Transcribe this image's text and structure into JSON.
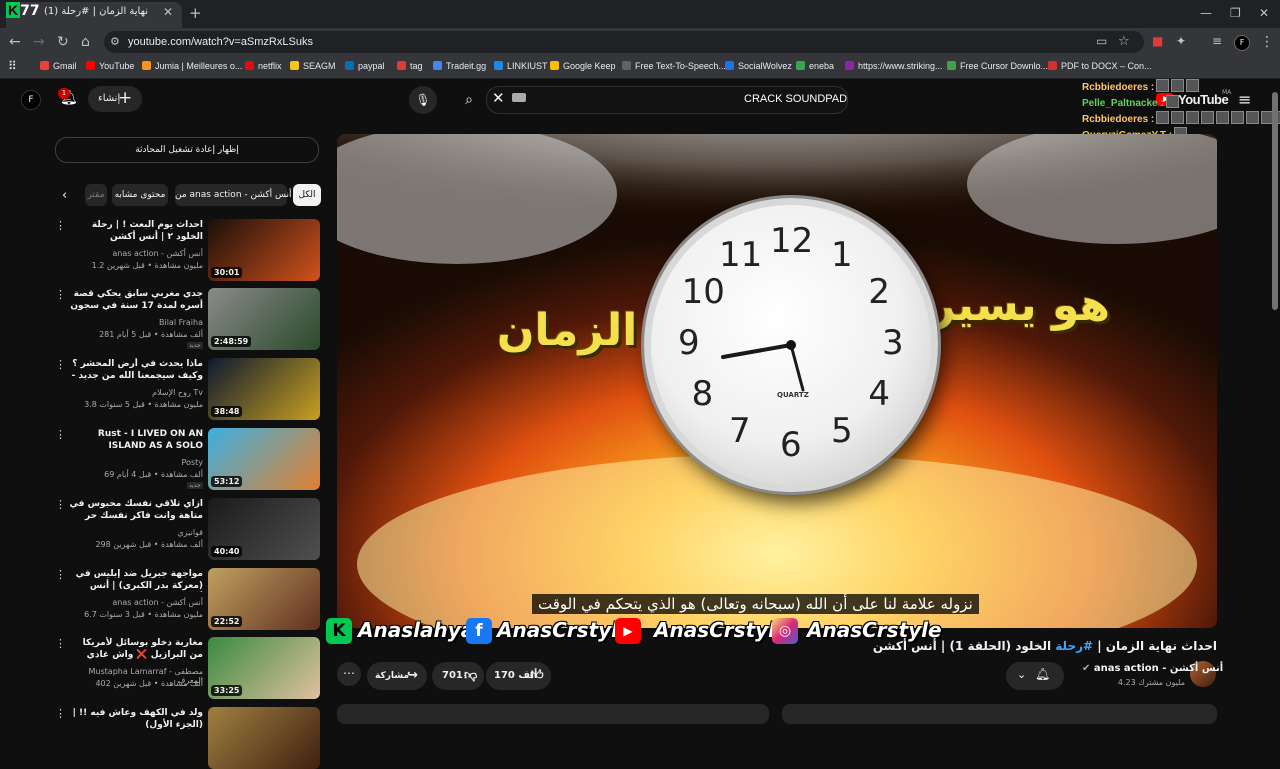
{
  "browser": {
    "tab_title": "(1) احداث نهاية الزمان | #رحلة",
    "tab_logo": "K77",
    "url": "youtube.com/watch?v=aSmzRxLSuks",
    "bookmarks": [
      "Gmail",
      "YouTube",
      "Jumia | Meilleures o...",
      "netflix",
      "SEAGM",
      "paypal",
      "tag",
      "Tradeit.gg",
      "LINKIUST",
      "Google Keep",
      "Free Text-To-Speech...",
      "SocialWolvez",
      "eneba",
      "https://www.striking...",
      "Free Cursor Downlo...",
      "PDF to DOCX – Con..."
    ],
    "bookmark_colors": [
      "#ea4335",
      "#ff0000",
      "#f7931e",
      "#e50914",
      "#f5c518",
      "#0070ba",
      "#e53935",
      "#4285f4",
      "#1e88e5",
      "#fbbc04",
      "#5f6368",
      "#1a73e8",
      "#34a853",
      "#8e24aa",
      "#43a047",
      "#d32f2f"
    ]
  },
  "header": {
    "avatar_letter": "F",
    "notif_count": "1",
    "create_label": "إنشاء",
    "search_query": "CRACK SOUNDPAD",
    "logo_text": "YouTube",
    "logo_region": "MA"
  },
  "chat_overlay": [
    {
      "user": "Rcbbiedoeres :",
      "color": "#ffc56b",
      "emotes": 3
    },
    {
      "user": "Pelle_Paltnacke :",
      "color": "#5fd35f",
      "emotes": 1
    },
    {
      "user": "Rcbbiedoeres :",
      "color": "#ffc56b",
      "emotes": 9
    },
    {
      "user": "QueryziGamezY.T :",
      "color": "#ffd000",
      "emotes": 1
    }
  ],
  "sidebar": {
    "chat_replay": "إظهار إعادة تشغيل المحادثة",
    "chips": [
      "الكل",
      "من anas action - أنس أكشن",
      "محتوى مشابه",
      "مقتر"
    ],
    "recommendations": [
      {
        "title": "احداث يوم البعث ! | رحلة الخلود ٢ | أنس أكشن",
        "channel": "anas action - أنس أكشن",
        "meta": "1.2 مليون مشاهدة • قبل شهرين",
        "duration": "30:01",
        "thumb": [
          "#1a0f0a",
          "#d2521c"
        ]
      },
      {
        "title": "جدي مغربي سابق يحكي قصة أسره لمدة 17 سنة في سجون البوليساريو | Dekka ...",
        "channel": "Bilal Fraiha",
        "meta": "281 ألف مشاهدة • قبل 5 أيام",
        "duration": "2:48:59",
        "thumb": [
          "#8a8a8a",
          "#2a4a2a"
        ],
        "new": "جديد"
      },
      {
        "title": "ماذا يحدث في أرض المحشر ؟ وكيف سيجمعنا الله من جديد - درس في منتهى الروعة للشي...",
        "channel": "روح الإسلام Tv",
        "meta": "3.8 مليون مشاهدة • قبل 5 سنوات",
        "duration": "38:48",
        "thumb": [
          "#0d1a30",
          "#c9a020"
        ]
      },
      {
        "title": "Rust - I LIVED ON AN ISLAND AS A SOLO",
        "channel": "Posty",
        "meta": "69 ألف مشاهدة • قبل 4 أيام",
        "duration": "53:12",
        "thumb": [
          "#3bb0e0",
          "#e08030"
        ],
        "new": "جديد"
      },
      {
        "title": "ازاي تلاقي نفسك محبوس في متاهة وانت فاكر نفسك حر !!؟ | Prisoners",
        "channel": "قوانيزي",
        "meta": "298 ألف مشاهدة • قبل شهرين",
        "duration": "40:40",
        "thumb": [
          "#1a1a1a",
          "#505050"
        ]
      },
      {
        "title": "مواجهة جبريل ضد إبليس في (معركة بدر الكبرى) | أنس أكشن",
        "channel": "anas action - أنس أكشن",
        "meta": "6.7 مليون مشاهدة • قبل 3 سنوات",
        "duration": "22:52",
        "thumb": [
          "#c0a060",
          "#603020"
        ]
      },
      {
        "title": "مغاربة دخلو بوسائل لأمريكا من البرازيل ❌ واش غادي يقدر 😢🇧🇷",
        "channel": "Mustapha Lamarraf - مصطفى المعرف",
        "meta": "402 ألف مشاهدة • قبل شهرين",
        "duration": "33:25",
        "thumb": [
          "#3a8a40",
          "#e0c0a0"
        ]
      },
      {
        "title": "ولد في الكهف وعاش فيه !! | (الجزء الأول)",
        "channel": "",
        "meta": "",
        "duration": "",
        "thumb": [
          "#a08040",
          "#402010"
        ]
      }
    ]
  },
  "video": {
    "overlay_text": "هو يسير الزمان",
    "clock_brand": "QUARTZ",
    "clock_numbers": [
      "12",
      "1",
      "2",
      "3",
      "4",
      "5",
      "6",
      "7",
      "8",
      "9",
      "10",
      "11"
    ],
    "subtitle": "نزوله علامة لنا على أن الله (سبحانه وتعالى) هو الذي يتحكم في الوقت",
    "social_handles": [
      "Anaslahya",
      "AnasCrstyle",
      "AnasCrstyle",
      "AnasCrstyle"
    ],
    "title_prefix": "احداث نهاية الزمان | ",
    "title_hash": "#رحلة",
    "title_suffix": " الخلود (الحلقة 1) | أنس أكشن",
    "channel_name": "anas action - أنس أكشن",
    "subscribers": "4.23 مليون مشترك",
    "likes": "170 ألف",
    "dislikes": "701",
    "share": "مشاركة",
    "more": "⋯"
  }
}
